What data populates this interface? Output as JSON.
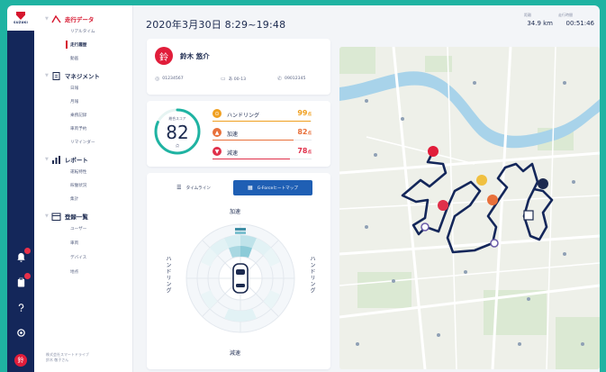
{
  "brand": {
    "name": "SUZUKI"
  },
  "rail": {
    "icons": [
      "bell-icon",
      "clipboard-icon",
      "help-icon",
      "settings-icon"
    ],
    "avatar_glyph": "鈴"
  },
  "menu": {
    "groups": [
      {
        "label": "走行データ",
        "items": [
          "リアルタイム",
          "走行履歴",
          "動画"
        ]
      },
      {
        "label": "マネジメント",
        "items": [
          "日報",
          "月報",
          "乗務記録",
          "車両予約",
          "リマインダー"
        ]
      },
      {
        "label": "レポート",
        "items": [
          "運転特性",
          "稼働状況",
          "集計"
        ]
      },
      {
        "label": "登録一覧",
        "items": [
          "ユーザー",
          "車両",
          "デバイス",
          "地点"
        ]
      }
    ],
    "active_item": "走行履歴",
    "company": "株式会社スマートドライブ",
    "user": "鈴木 敬子さん"
  },
  "header": {
    "date_range": "2020年3月30日  8:29~19:48",
    "distance_label": "距離",
    "distance_value": "34.9 km",
    "time_label": "走行時間",
    "time_value": "00:51:46"
  },
  "driver": {
    "avatar_glyph": "鈴",
    "name": "鈴木 悠介",
    "id_number": "01234567",
    "plate": "あ 00-13",
    "phone": "09012345"
  },
  "score": {
    "label": "総合スコア",
    "value": 82,
    "unit": "点",
    "items": [
      {
        "name": "ハンドリング",
        "score": "99",
        "unit": "点",
        "color": "#f0a020",
        "ratio": 0.99
      },
      {
        "name": "加速",
        "score": "82",
        "unit": "点",
        "color": "#e8703a",
        "ratio": 0.82
      },
      {
        "name": "減速",
        "score": "78",
        "unit": "点",
        "color": "#e0304a",
        "ratio": 0.78
      }
    ]
  },
  "gforce": {
    "tabs": [
      {
        "label": "タイムライン",
        "icon": "list-icon",
        "active": false
      },
      {
        "label": "G-Forceヒートマップ",
        "icon": "heatmap-icon",
        "active": true
      }
    ],
    "top_label": "加速",
    "bottom_label": "減速",
    "left_label": "ハンドリング",
    "right_label": "ハンドリング"
  },
  "colors": {
    "accent_red": "#d6162e",
    "navy": "#14275a",
    "route": "#14275a",
    "tab_active": "#1f5fb4",
    "teal": "#1fb3a2"
  }
}
